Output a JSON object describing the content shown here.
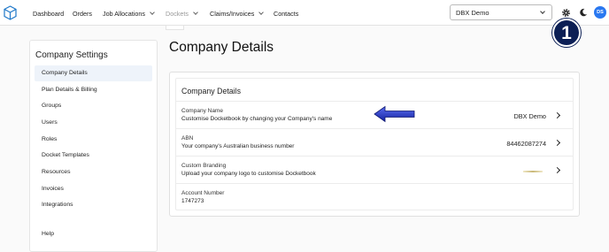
{
  "nav": {
    "items": [
      {
        "label": "Dashboard",
        "dim": false,
        "chevron": false
      },
      {
        "label": "Orders",
        "dim": false,
        "chevron": false
      },
      {
        "label": "Job Allocations",
        "dim": false,
        "chevron": true
      },
      {
        "label": "Dockets",
        "dim": true,
        "chevron": true
      },
      {
        "label": "Claims/Invoices",
        "dim": false,
        "chevron": true
      },
      {
        "label": "Contacts",
        "dim": false,
        "chevron": false
      }
    ],
    "company_select": "DBX Demo",
    "avatar_initials": "DS",
    "step_badge": "1"
  },
  "sidebar": {
    "title": "Company Settings",
    "items": [
      {
        "label": "Company Details",
        "active": true
      },
      {
        "label": "Plan Details & Billing",
        "active": false
      },
      {
        "label": "Groups",
        "active": false
      },
      {
        "label": "Users",
        "active": false
      },
      {
        "label": "Roles",
        "active": false
      },
      {
        "label": "Docket Templates",
        "active": false
      },
      {
        "label": "Resources",
        "active": false
      },
      {
        "label": "Invoices",
        "active": false
      },
      {
        "label": "Integrations",
        "active": false
      },
      {
        "label": "Help",
        "active": false
      }
    ]
  },
  "main": {
    "page_title": "Company Details",
    "card_title": "Company Details",
    "rows": [
      {
        "label": "Company Name",
        "description": "Customise Docketbook by changing your Company's name",
        "value": "DBX Demo"
      },
      {
        "label": "ABN",
        "description": "Your company's Australian business number",
        "value": "84462087274"
      },
      {
        "label": "Custom Branding",
        "description": "Upload your company logo to customise Docketbook",
        "value": ""
      },
      {
        "label": "Account Number",
        "description": "1747273",
        "value": ""
      }
    ]
  },
  "colors": {
    "accent": "#2a78f0",
    "badge": "#0c1f55",
    "arrow": "#1f2db8"
  }
}
